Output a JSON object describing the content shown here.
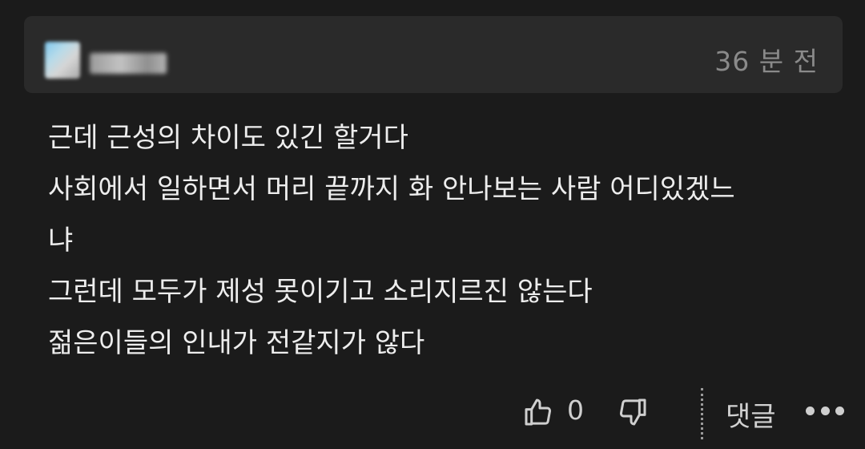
{
  "comment": {
    "timestamp": "36 분 전",
    "lines": [
      "근데 근성의 차이도 있긴 할거다",
      "사회에서 일하면서 머리 끝까지 화 안나보는 사람 어디있겠느",
      "냐",
      "그런데 모두가 제성 못이기고 소리지르진 않는다",
      "젊은이들의 인내가 전같지가 않다"
    ],
    "like_count": "0",
    "reply_label": "댓글"
  },
  "icons": {
    "avatar": "avatar",
    "like": "thumbs-up-icon",
    "dislike": "thumbs-down-icon",
    "more": "more-dots-icon"
  },
  "colors": {
    "background": "#1b1b1b",
    "header_card": "#2a2a2a",
    "text": "#ededed",
    "muted": "#8a8a8a"
  }
}
